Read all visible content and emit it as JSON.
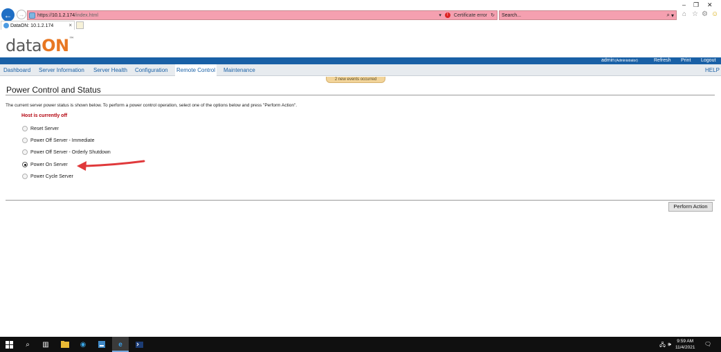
{
  "browser": {
    "url_scheme": "https://",
    "url_host": "10.1.2.174",
    "url_path": "/index.html",
    "cert_error": "Certificate error",
    "search_placeholder": "Search...",
    "tab_title": "DataON: 10.1.2.174",
    "tab_close": "×"
  },
  "window_controls": {
    "minimize": "–",
    "restore": "❐",
    "close": "✕"
  },
  "logo": {
    "part1": "data",
    "part2": "ON",
    "tm": "™"
  },
  "topbar": {
    "user": "admin",
    "role": "(Administrator)",
    "refresh": "Refresh",
    "print": "Print",
    "logout": "Logout"
  },
  "nav": {
    "items": [
      {
        "label": "Dashboard"
      },
      {
        "label": "Server Information"
      },
      {
        "label": "Server Health"
      },
      {
        "label": "Configuration"
      },
      {
        "label": "Remote Control"
      },
      {
        "label": "Maintenance"
      }
    ],
    "active": "Remote Control",
    "help": "HELP"
  },
  "events_notice": "2 new events occurred",
  "page": {
    "title": "Power Control and Status",
    "instructions": "The current server power status is shown below. To perform a power control operation, select one of the options below and press \"Perform Action\".",
    "host_status": "Host is currently off",
    "options": [
      {
        "label": "Reset Server",
        "checked": false
      },
      {
        "label": "Power Off Server - Immediate",
        "checked": false
      },
      {
        "label": "Power Off Server - Orderly Shutdown",
        "checked": false
      },
      {
        "label": "Power On Server",
        "checked": true
      },
      {
        "label": "Power Cycle Server",
        "checked": false
      }
    ],
    "perform_button": "Perform Action"
  },
  "colors": {
    "accent_blue": "#1960a6",
    "logo_orange": "#e87722",
    "status_red": "#b3000c",
    "annotation_arrow": "#e0393b"
  },
  "taskbar": {
    "time": "9:59 AM",
    "date": "11/4/2021"
  }
}
